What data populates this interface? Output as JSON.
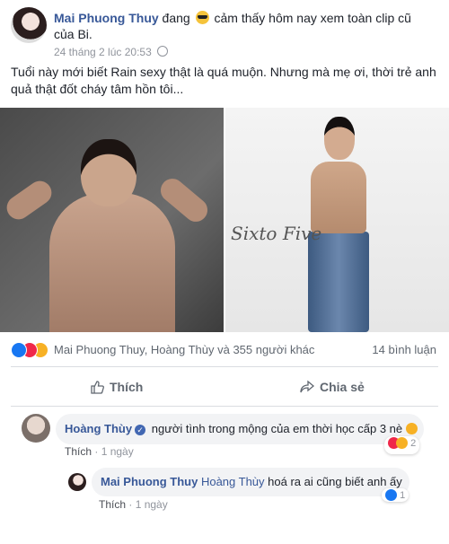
{
  "post": {
    "author": "Mai Phuong Thuy",
    "status_pre": "đang",
    "feeling_icon": "cool-emoji",
    "status_post": "cảm thấy hôm nay xem toàn clip cũ của Bi.",
    "timestamp": "24 tháng 2 lúc 20:53",
    "privacy_icon": "globe-icon",
    "text": "Tuổi này mới biết Rain sexy thật là quá muộn. Nhưng mà mẹ ơi, thời trẻ anh quả thật đốt cháy tâm hồn tôi...",
    "photo_caption": "Sixto Five"
  },
  "reactions": {
    "names": "Mai Phuong Thuy, Hoàng Thùy và 355 người khác",
    "comment_count": "14 bình luận"
  },
  "actions": {
    "like_label": "Thích",
    "share_label": "Chia sẻ"
  },
  "comments": [
    {
      "author": "Hoàng Thùy",
      "text": "người tình trong mộng của em thời học cấp 3 nè",
      "like_label": "Thích",
      "time": "1 ngày",
      "reaction_count": "2"
    },
    {
      "author": "Mai Phuong Thuy",
      "tag": "Hoàng Thùy",
      "text": "hoá ra ai cũng biết anh ấy",
      "like_label": "Thích",
      "time": "1 ngày",
      "reaction_count": "1"
    }
  ],
  "colors": {
    "link": "#385898",
    "like": "#1877f2",
    "love": "#f0284a",
    "haha": "#f7b125"
  }
}
